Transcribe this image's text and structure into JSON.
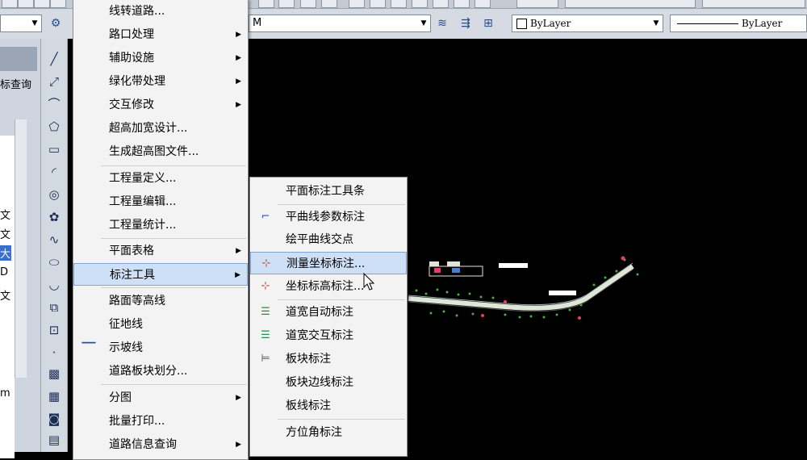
{
  "toolbar": {
    "layer_combo_value": "M",
    "color_combo_value": "ByLayer",
    "linetype_combo_value": "ByLayer"
  },
  "left_panel": {
    "tab_label": "标查询",
    "side_chars": [
      "文",
      "文",
      "大",
      "D",
      "文",
      "m"
    ]
  },
  "menu1": {
    "items": [
      {
        "label": "线转道路...",
        "submenu": false
      },
      {
        "label": "路口处理",
        "submenu": true
      },
      {
        "label": "辅助设施",
        "submenu": true
      },
      {
        "label": "绿化带处理",
        "submenu": true
      },
      {
        "label": "交互修改",
        "submenu": true
      },
      {
        "label": "超高加宽设计...",
        "submenu": false
      },
      {
        "label": "生成超高图文件...",
        "submenu": false
      },
      {
        "label": "工程量定义...",
        "submenu": false
      },
      {
        "label": "工程量编辑...",
        "submenu": false
      },
      {
        "label": "工程量统计...",
        "submenu": false
      },
      {
        "label": "平面表格",
        "submenu": true
      },
      {
        "label": "标注工具",
        "submenu": true
      },
      {
        "label": "路面等高线",
        "submenu": false
      },
      {
        "label": "征地线",
        "submenu": false
      },
      {
        "label": "示坡线",
        "submenu": false
      },
      {
        "label": "道路板块划分...",
        "submenu": false
      },
      {
        "label": "分图",
        "submenu": true
      },
      {
        "label": "批量打印...",
        "submenu": false
      },
      {
        "label": "道路信息查询",
        "submenu": true
      }
    ]
  },
  "menu2": {
    "items": [
      {
        "label": "平面标注工具条"
      },
      {
        "label": "平曲线参数标注"
      },
      {
        "label": "绘平曲线交点"
      },
      {
        "label": "测量坐标标注..."
      },
      {
        "label": "坐标标高标注..."
      },
      {
        "label": "道宽自动标注"
      },
      {
        "label": "道宽交互标注"
      },
      {
        "label": "板块标注"
      },
      {
        "label": "板块边线标注"
      },
      {
        "label": "板线标注"
      },
      {
        "label": "方位角标注"
      }
    ]
  },
  "colors": {
    "canvas": "#000000",
    "menu_bg": "#f3f3f3",
    "highlight": "#cde0f5",
    "road": "#dfe6d8",
    "vegetation": "#4caf3d",
    "marker": "#e83a6b"
  }
}
